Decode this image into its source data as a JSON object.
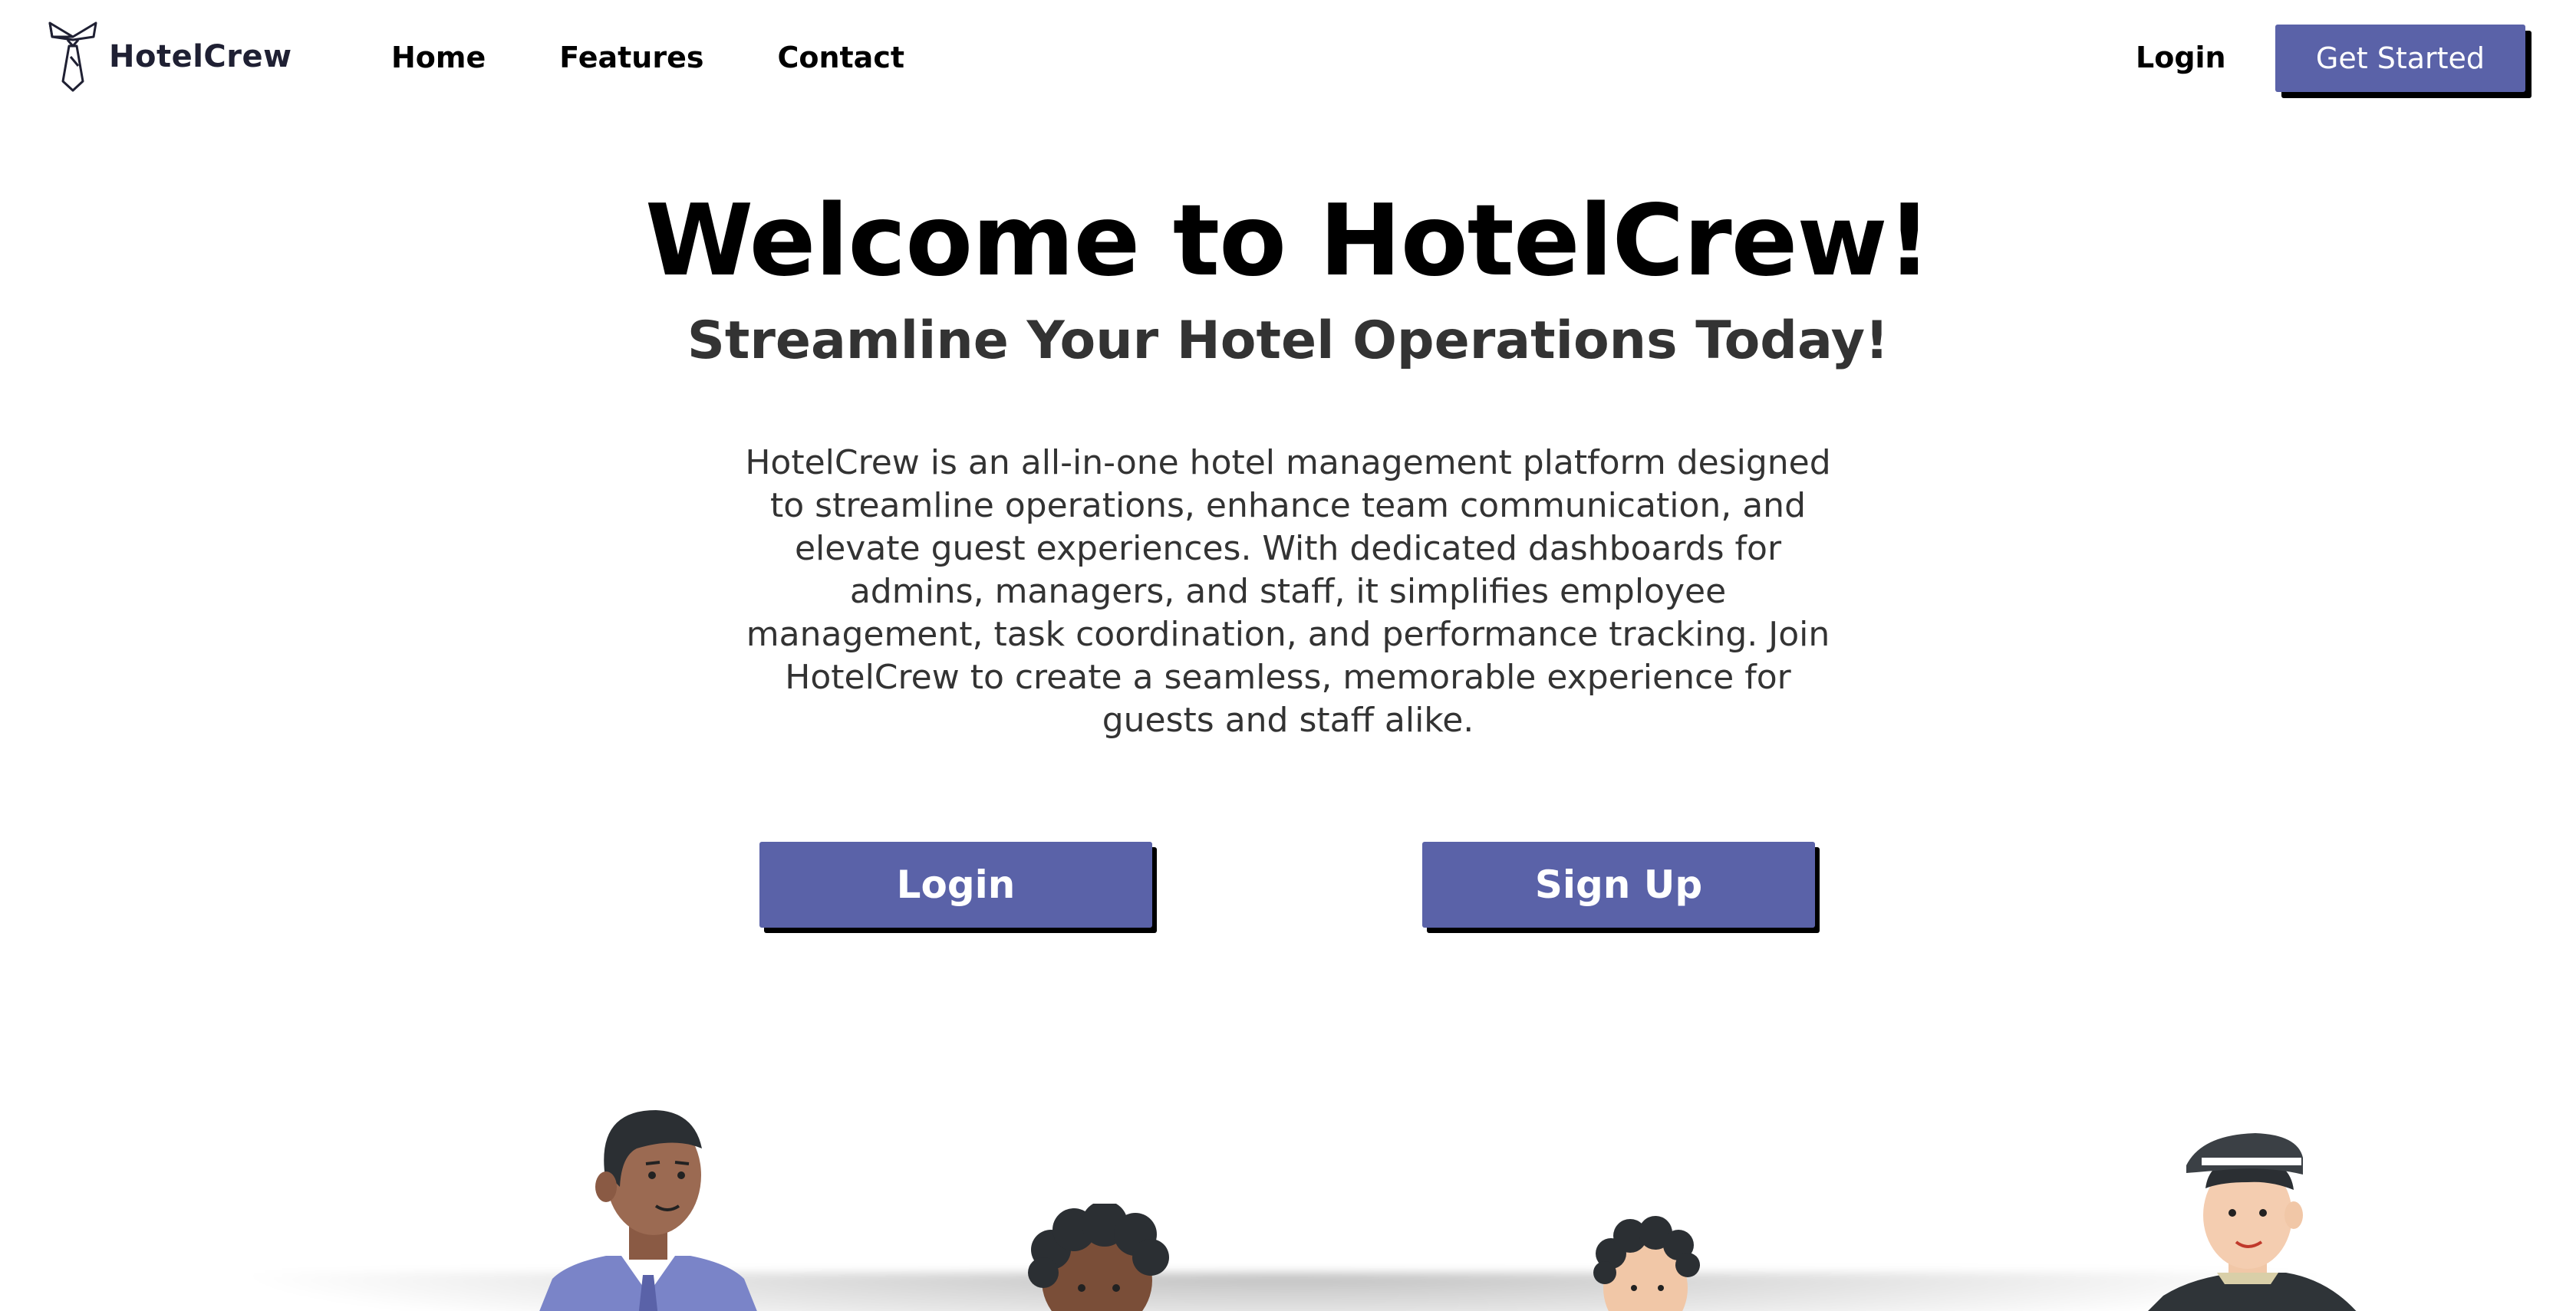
{
  "brand": {
    "name": "HotelCrew",
    "logo_icon": "bowtie-tie-icon"
  },
  "nav": {
    "links": [
      {
        "label": "Home"
      },
      {
        "label": "Features"
      },
      {
        "label": "Contact"
      }
    ],
    "login_label": "Login",
    "get_started_label": "Get Started"
  },
  "hero": {
    "title": "Welcome to HotelCrew!",
    "subtitle": "Streamline Your Hotel Operations Today!",
    "description": "HotelCrew is an all-in-one hotel management platform designed to streamline operations, enhance team communication, and elevate guest experiences. With dedicated dashboards for admins, managers, and staff, it simplifies employee management, task coordination, and performance tracking. Join HotelCrew to create a seamless, memorable experience for guests and staff alike.",
    "login_button": "Login",
    "signup_button": "Sign Up"
  },
  "colors": {
    "accent": "#5a62a8",
    "text_dark": "#000000",
    "text_muted": "#333333",
    "background": "#ffffff"
  },
  "illustration": {
    "figures": [
      "businessman-illustration",
      "curly-hair-staff-illustration",
      "curly-hair-boy-illustration",
      "bellhop-illustration"
    ]
  }
}
